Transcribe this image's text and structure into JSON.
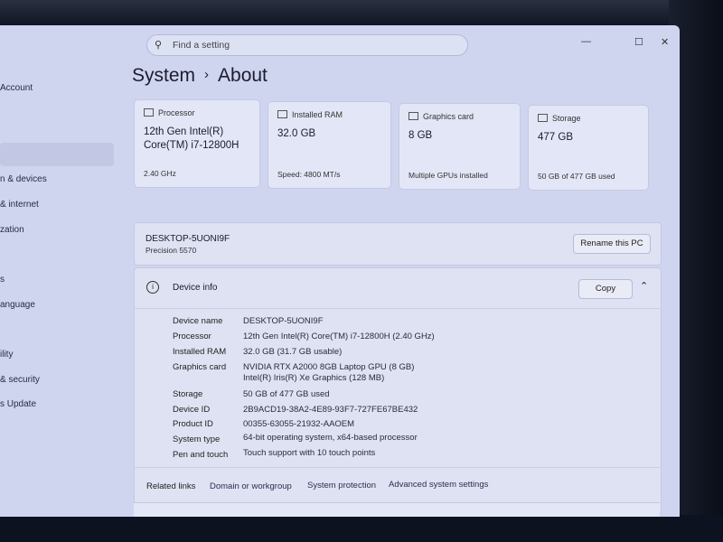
{
  "search": {
    "placeholder": "Find a setting",
    "icon": "search-icon"
  },
  "window_controls": {
    "minimize": "—",
    "maximize": "☐",
    "close": "✕"
  },
  "sidebar": {
    "items": [
      {
        "label": "Account"
      },
      {
        "label": "n & devices"
      },
      {
        "label": "& internet"
      },
      {
        "label": "zation"
      },
      {
        "label": "s"
      },
      {
        "label": "anguage"
      },
      {
        "label": "ility"
      },
      {
        "label": "& security"
      },
      {
        "label": "s Update"
      }
    ]
  },
  "breadcrumb": {
    "parent": "System",
    "separator": "›",
    "current": "About"
  },
  "cards": [
    {
      "label": "Processor",
      "value": "12th Gen Intel(R) Core(TM) i7-12800H",
      "sub": "2.40 GHz"
    },
    {
      "label": "Installed RAM",
      "value": "32.0 GB",
      "sub": "Speed: 4800 MT/s"
    },
    {
      "label": "Graphics card",
      "value": "8 GB",
      "sub": "Multiple GPUs installed"
    },
    {
      "label": "Storage",
      "value": "477 GB",
      "sub": "50 GB of 477 GB used"
    }
  ],
  "pc": {
    "name": "DESKTOP-5UONI9F",
    "model": "Precision 5570",
    "rename_label": "Rename this PC"
  },
  "device_info": {
    "title": "Device info",
    "copy_label": "Copy",
    "rows": [
      {
        "key": "Device name",
        "value": "DESKTOP-5UONI9F"
      },
      {
        "key": "Processor",
        "value": "12th Gen Intel(R) Core(TM) i7-12800H (2.40 GHz)"
      },
      {
        "key": "Installed RAM",
        "value": "32.0 GB (31.7 GB usable)"
      },
      {
        "key": "Graphics card",
        "value": "NVIDIA RTX A2000 8GB Laptop GPU (8 GB)",
        "value2": "Intel(R) Iris(R) Xe Graphics (128 MB)"
      },
      {
        "key": "Storage",
        "value": "50 GB of 477 GB used"
      },
      {
        "key": "Device ID",
        "value": "2B9ACD19-38A2-4E89-93F7-727FE67BE432"
      },
      {
        "key": "Product ID",
        "value": "00355-63055-21932-AAOEM"
      },
      {
        "key": "System type",
        "value": "64-bit operating system, x64-based processor"
      },
      {
        "key": "Pen and touch",
        "value": "Touch support with 10 touch points"
      }
    ]
  },
  "related_links": {
    "title": "Related links",
    "links": [
      "Domain or workgroup",
      "System protection",
      "Advanced system settings"
    ]
  }
}
